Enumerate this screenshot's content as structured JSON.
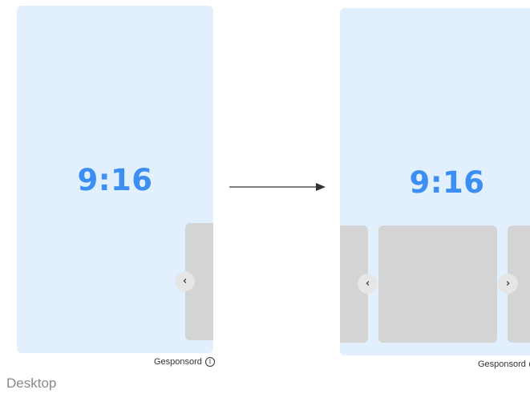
{
  "left_mock": {
    "ratio_label": "9:16",
    "prev_glyph": "‹",
    "sponsored_label": "Gesponsord",
    "info_glyph": "i"
  },
  "right_mock": {
    "ratio_label": "9:16",
    "prev_glyph": "‹",
    "next_glyph": "›",
    "sponsored_label": "Gesponsord",
    "info_glyph": "i"
  },
  "caption": "Desktop",
  "colors": {
    "panel_bg": "#e1f0fc",
    "ratio_text": "#3d8ef2",
    "card": "#d4d4d4",
    "arrow": "#333333"
  }
}
